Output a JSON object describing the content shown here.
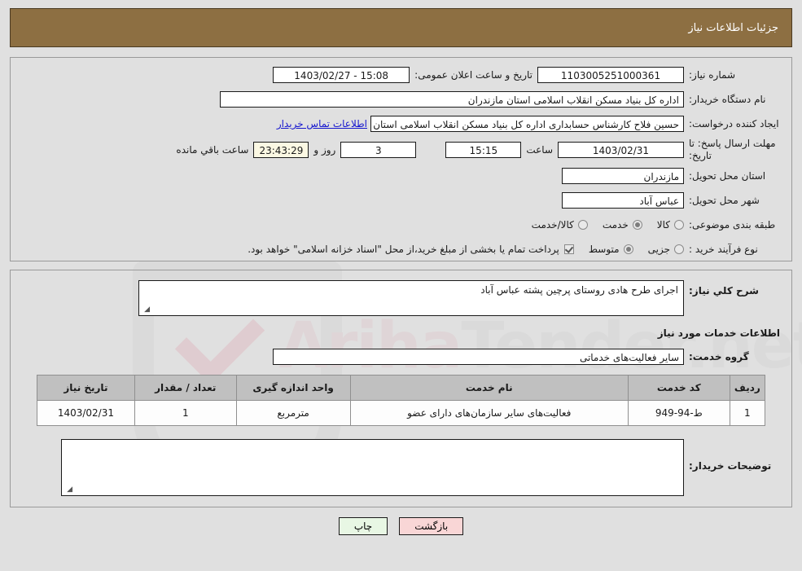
{
  "header": {
    "title": "جزئیات اطلاعات نیاز",
    "bar_color": "#8d6f42"
  },
  "top_panel": {
    "need_number": {
      "label": "شماره نیاز:",
      "value": "1103005251000361"
    },
    "announce": {
      "label": "تاریخ و ساعت اعلان عمومی:",
      "value": "15:08 - 1403/02/27"
    },
    "buyer_org": {
      "label": "نام دستگاه خریدار:",
      "value": "اداره کل بنیاد مسکن انقلاب اسلامی استان مازندران"
    },
    "creator": {
      "label": "ایجاد کننده درخواست:",
      "value": "حسین فلاح کارشناس حسابداری اداره کل بنیاد مسکن انقلاب اسلامی استان م",
      "link": "اطلاعات تماس خریدار",
      "link_color": "#1717cf"
    },
    "deadline": {
      "label": "مهلت ارسال پاسخ: تا تاریخ:",
      "date": "1403/02/31",
      "time_label": "ساعت",
      "time": "15:15",
      "days": "3",
      "days_label": "روز و",
      "countdown": "23:43:29",
      "countdown_label": "ساعت باقي مانده"
    },
    "province": {
      "label": "استان محل تحویل:",
      "value": "مازندران"
    },
    "city": {
      "label": "شهر محل تحویل:",
      "value": "عباس آباد"
    },
    "category": {
      "label": "طبقه بندی موضوعی:",
      "options": [
        "کالا",
        "خدمت",
        "کالا/خدمت"
      ],
      "selected": "خدمت"
    },
    "purchase_type": {
      "label": "نوع فرآیند خرید :",
      "options": [
        "جزیی",
        "متوسط"
      ],
      "selected": "متوسط",
      "checkbox_checked": true,
      "note": "پرداخت تمام یا بخشی از مبلغ خرید،از محل \"اسناد خزانه اسلامی\" خواهد بود."
    }
  },
  "bottom_panel": {
    "description": {
      "label": "شرح کلي نیاز:",
      "value": "اجرای طرح هادی روستای پرچین پشته عباس آباد"
    },
    "services_section_title": "اطلاعات خدمات مورد نیاز",
    "service_group": {
      "label": "گروه خدمت:",
      "value": "سایر فعالیت‌های خدماتی"
    },
    "table": {
      "columns": [
        "ردیف",
        "کد خدمت",
        "نام خدمت",
        "واحد اندازه گیری",
        "تعداد / مقدار",
        "تاریخ نیاز"
      ],
      "rows": [
        {
          "radif": "1",
          "code": "ط-94-949",
          "name": "فعالیت‌های سایر سازمان‌های دارای عضو",
          "unit": "مترمربع",
          "qty": "1",
          "date": "1403/02/31"
        }
      ]
    },
    "buyer_notes": {
      "label": "توضیحات خریدار:",
      "value": ""
    }
  },
  "footer": {
    "back_button": "بازگشت",
    "print_button": "چاپ"
  },
  "watermark": {
    "text_left": "Ariha",
    "text_right": "Tender.net"
  }
}
